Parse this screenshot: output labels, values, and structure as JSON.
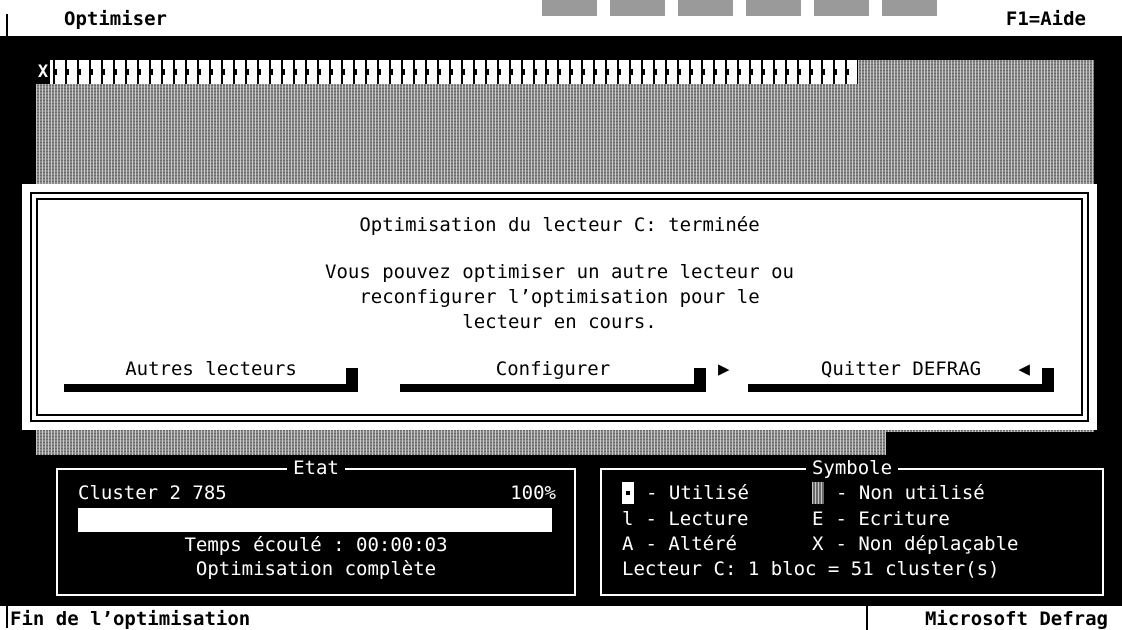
{
  "app": {
    "menu_title": "Optimiser",
    "help_hint": "F1=Aide"
  },
  "disk_map": {
    "unmovable_symbol": "X"
  },
  "dialog": {
    "title": "Optimisation du lecteur C: terminée",
    "message": "Vous pouvez optimiser un autre lecteur ou\nreconfigurer l’optimisation pour le\nlecteur en cours.",
    "buttons": {
      "other_drives": "Autres lecteurs",
      "configure": "Configurer",
      "quit": "Quitter DEFRAG"
    },
    "default_arrow_left": "▶",
    "default_arrow_right": "◀"
  },
  "status": {
    "title": "Etat",
    "cluster": "Cluster 2 785",
    "percent": "100%",
    "progress": 1.0,
    "elapsed": "Temps écoulé : 00:00:03",
    "message": "Optimisation complète"
  },
  "legend": {
    "title": "Symbole",
    "used": "- Utilisé",
    "unused": "- Non utilisé",
    "read_symbol": "l",
    "read": "- Lecture",
    "write_symbol": "E",
    "write": "- Ecriture",
    "bad_symbol": "A",
    "bad": "- Altéré",
    "unmovable_symbol": "X",
    "unmovable": "- Non déplaçable",
    "drive_info": "Lecteur C: 1 bloc = 51 cluster(s)"
  },
  "statusbar": {
    "left": "Fin de l’optimisation",
    "right": "Microsoft Defrag"
  }
}
